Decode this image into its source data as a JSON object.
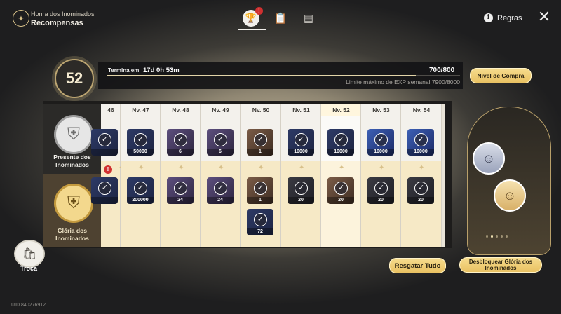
{
  "header": {
    "title": "Honra dos Inominados",
    "subtitle": "Recompensas",
    "rules_label": "Regras",
    "tab_badge": "!"
  },
  "level": {
    "current": "52",
    "ends_label": "Termina em",
    "ends_value": "17d 0h 53m",
    "exp_text": "700/800",
    "exp_fraction": 0.875,
    "weekly_limit": "Limite máximo de EXP semanal 7900/8000",
    "buy_button": "Nível de Compra"
  },
  "tracks": {
    "free_label": "Presente dos Inominados",
    "premium_label": "Glória dos Inominados",
    "alert": "!"
  },
  "columns": [
    {
      "level": "46",
      "top": "",
      "bottom": [
        ""
      ]
    },
    {
      "level": "Nv. 47",
      "top": "50000",
      "bottom": [
        "200000"
      ]
    },
    {
      "level": "Nv. 48",
      "top": "6",
      "bottom": [
        "24"
      ]
    },
    {
      "level": "Nv. 49",
      "top": "6",
      "bottom": [
        "24"
      ]
    },
    {
      "level": "Nv. 50",
      "top": "1",
      "bottom": [
        "1",
        "72"
      ]
    },
    {
      "level": "Nv. 51",
      "top": "10000",
      "bottom": [
        "20"
      ]
    },
    {
      "level": "Nv. 52",
      "top": "10000",
      "bottom": [
        "20"
      ]
    },
    {
      "level": "Nv. 53",
      "top": "10000",
      "bottom": [
        "20"
      ]
    },
    {
      "level": "Nv. 54",
      "top": "10000",
      "bottom": [
        "20"
      ]
    }
  ],
  "buttons": {
    "claim_all": "Resgatar Tudo",
    "unlock": "Desbloquear Glória dos Inominados"
  },
  "trade": {
    "label": "Troca"
  },
  "uid": "UID 840276912",
  "icons": [
    "emblem-icon",
    "trophy-icon",
    "clipboard-icon",
    "card-icon",
    "info-icon",
    "close-icon",
    "checkmark-icon",
    "bag-icon"
  ]
}
